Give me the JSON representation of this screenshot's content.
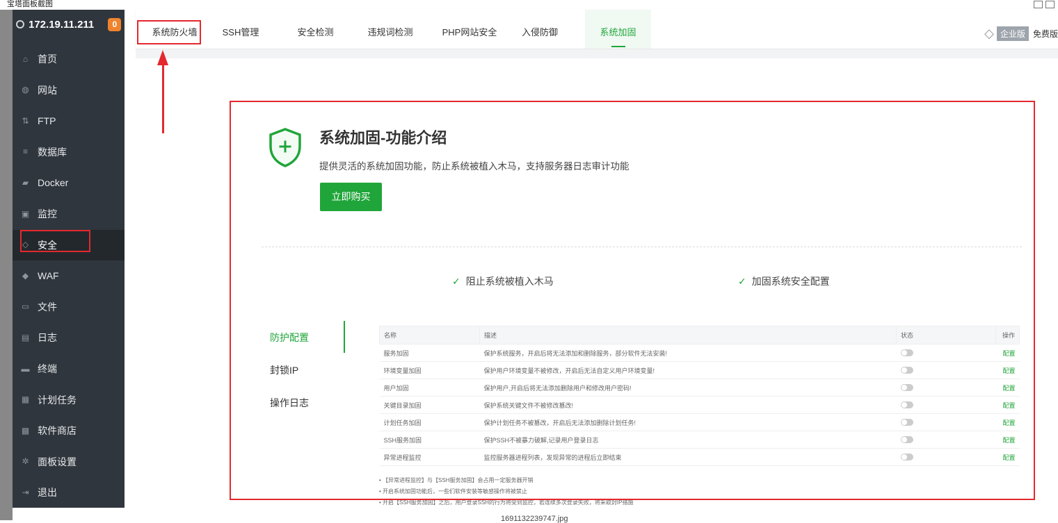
{
  "window": {
    "title": "宝塔面板截图"
  },
  "sidebar": {
    "server_ip": "172.19.11.211",
    "badge": "0",
    "items": [
      {
        "label": "首页",
        "icon": "home-icon"
      },
      {
        "label": "网站",
        "icon": "globe-icon"
      },
      {
        "label": "FTP",
        "icon": "ftp-icon"
      },
      {
        "label": "数据库",
        "icon": "database-icon"
      },
      {
        "label": "Docker",
        "icon": "docker-icon"
      },
      {
        "label": "监控",
        "icon": "monitor-icon"
      },
      {
        "label": "安全",
        "icon": "shield-icon"
      },
      {
        "label": "WAF",
        "icon": "waf-shield-icon"
      },
      {
        "label": "文件",
        "icon": "folder-icon"
      },
      {
        "label": "日志",
        "icon": "log-icon"
      },
      {
        "label": "终端",
        "icon": "terminal-icon"
      },
      {
        "label": "计划任务",
        "icon": "calendar-icon"
      },
      {
        "label": "软件商店",
        "icon": "apps-icon"
      },
      {
        "label": "面板设置",
        "icon": "settings-icon"
      },
      {
        "label": "退出",
        "icon": "logout-icon"
      }
    ],
    "active_index": 6
  },
  "tabs": {
    "items": [
      "系统防火墙",
      "SSH管理",
      "安全检测",
      "违规词检测",
      "PHP网站安全",
      "入侵防御",
      "系统加固"
    ],
    "active_index": 6
  },
  "edition": {
    "label": "企业版",
    "free_label": "免费版"
  },
  "intro": {
    "title": "系统加固-功能介绍",
    "subtitle": "提供灵活的系统加固功能，防止系统被植入木马，支持服务器日志审计功能",
    "buy_button": "立即购买",
    "features": [
      "阻止系统被植入木马",
      "加固系统安全配置"
    ]
  },
  "subnav": {
    "items": [
      "防护配置",
      "封锁IP",
      "操作日志"
    ],
    "active_index": 0
  },
  "table": {
    "headers": {
      "name": "名称",
      "desc": "描述",
      "status": "状态",
      "op": "操作"
    },
    "rows": [
      {
        "name": "服务加固",
        "desc": "保护系统服务，开启后将无法添加和删除服务，部分软件无法安装!",
        "op": "配置"
      },
      {
        "name": "环境变量加固",
        "desc": "保护用户环境变量不被修改，开启后无法自定义用户环境变量!",
        "op": "配置"
      },
      {
        "name": "用户加固",
        "desc": "保护用户,开启后将无法添加删除用户和修改用户密码!",
        "op": "配置"
      },
      {
        "name": "关键目录加固",
        "desc": "保护系统关键文件不被修改篡改!",
        "op": "配置"
      },
      {
        "name": "计划任务加固",
        "desc": "保护计划任务不被篡改，开启后无法添加删除计划任务!",
        "op": "配置"
      },
      {
        "name": "SSH服务加固",
        "desc": "保护SSH不被暴力破解,记录用户登录日志",
        "op": "配置"
      },
      {
        "name": "异常进程监控",
        "desc": "监控服务器进程列表，发现异常的进程后立即结束",
        "op": "配置"
      }
    ]
  },
  "notes": [
    "【异常进程监控】与【SSH服务加固】会占用一定服务器开销",
    "开启系统加固功能后，一些们软件安装等敏感操作将被禁止",
    "开启【SSH服务加固】之后，用户登录SSH的行为将受到监控，若连续多次登录失败，将采取封IP措施"
  ],
  "footer": {
    "filename": "1691132239747.jpg"
  },
  "colors": {
    "accent": "#20a53a",
    "sidebar_bg": "#30363d",
    "annotation_red": "#e4282d"
  }
}
